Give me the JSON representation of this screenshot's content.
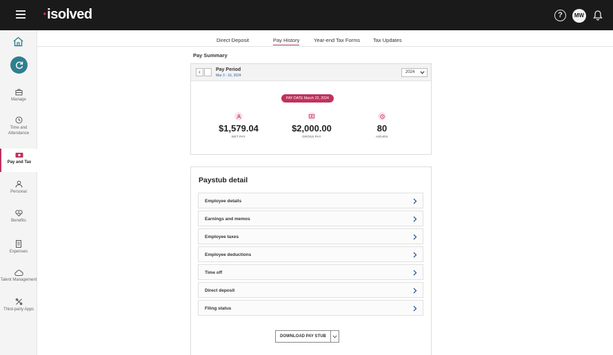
{
  "topbar": {
    "brand": "isolved",
    "brand_mark": "·",
    "avatar_initials": "MW"
  },
  "sidebar": {
    "items": [
      {
        "label": "Manage",
        "icon": "briefcase-icon"
      },
      {
        "label": "Time and Attendance",
        "icon": "clock-icon"
      },
      {
        "label": "Pay and Tax",
        "icon": "money-icon",
        "active": true
      },
      {
        "label": "Personal",
        "icon": "person-icon"
      },
      {
        "label": "Benefits",
        "icon": "heart-icon"
      },
      {
        "label": "Expenses",
        "icon": "receipt-icon"
      },
      {
        "label": "Talent Management",
        "icon": "cloud-icon"
      },
      {
        "label": "Third-party Apps",
        "icon": "tools-icon"
      }
    ]
  },
  "tabs": [
    {
      "label": "Direct Deposit"
    },
    {
      "label": "Pay History",
      "active": true
    },
    {
      "label": "Year-end Tax Forms"
    },
    {
      "label": "Tax Updates"
    }
  ],
  "summary": {
    "section_label": "Pay Summary",
    "period_title": "Pay Period",
    "period_dates": "Mar 3 - 16, 2024",
    "year": "2024",
    "pay_date": "PAY DATE March 22, 2024",
    "metrics": [
      {
        "value": "$1,579.04",
        "label": "NET PAY",
        "icon": "person-icon"
      },
      {
        "value": "$2,000.00",
        "label": "GROSS PAY",
        "icon": "money-icon"
      },
      {
        "value": "80",
        "label": "HOURS",
        "icon": "clock-icon"
      }
    ]
  },
  "detail": {
    "title": "Paystub detail",
    "rows": [
      {
        "label": "Employee details"
      },
      {
        "label": "Earnings and memos"
      },
      {
        "label": "Employee taxes"
      },
      {
        "label": "Employee deductions"
      },
      {
        "label": "Time off"
      },
      {
        "label": "Direct deposit"
      },
      {
        "label": "Filing status"
      }
    ],
    "download_label": "DOWNLOAD PAY STUB"
  },
  "colors": {
    "accent": "#c0325c",
    "brand_dot": "#e8315b",
    "topbar": "#1a1a1a",
    "teal": "#2f7f8f",
    "link": "#2a5aa0"
  }
}
